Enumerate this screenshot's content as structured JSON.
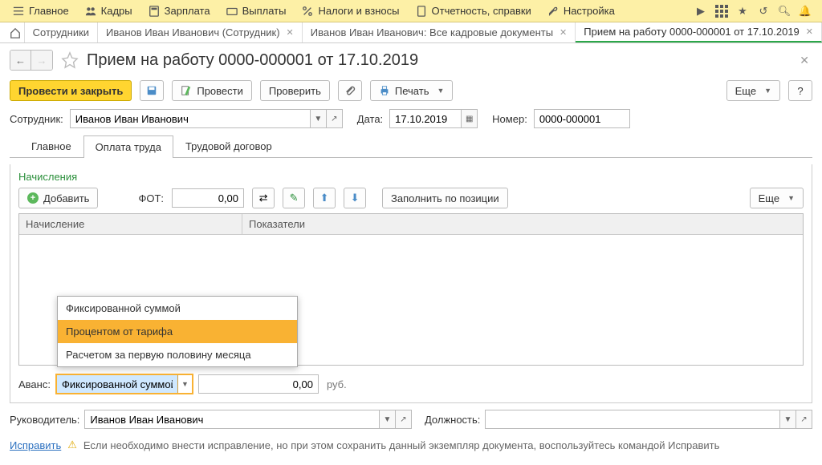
{
  "topmenu": {
    "items": [
      {
        "label": "Главное"
      },
      {
        "label": "Кадры"
      },
      {
        "label": "Зарплата"
      },
      {
        "label": "Выплаты"
      },
      {
        "label": "Налоги и взносы"
      },
      {
        "label": "Отчетность, справки"
      },
      {
        "label": "Настройка"
      }
    ]
  },
  "tabs": {
    "items": [
      {
        "label": "Сотрудники"
      },
      {
        "label": "Иванов Иван Иванович (Сотрудник)"
      },
      {
        "label": "Иванов Иван Иванович: Все кадровые документы"
      },
      {
        "label": "Прием на работу 0000-000001 от 17.10.2019"
      }
    ]
  },
  "page": {
    "title": "Прием на работу 0000-000001 от 17.10.2019"
  },
  "toolbar": {
    "post_close": "Провести и закрыть",
    "post": "Провести",
    "check": "Проверить",
    "print": "Печать",
    "more": "Еще",
    "help": "?"
  },
  "fields": {
    "employee_label": "Сотрудник:",
    "employee_value": "Иванов Иван Иванович",
    "date_label": "Дата:",
    "date_value": "17.10.2019",
    "number_label": "Номер:",
    "number_value": "0000-000001"
  },
  "inner_tabs": {
    "main": "Главное",
    "salary": "Оплата труда",
    "contract": "Трудовой договор"
  },
  "salary_tab": {
    "accruals_label": "Начисления",
    "add": "Добавить",
    "fot_label": "ФОТ:",
    "fot_value": "0,00",
    "fill_by_position": "Заполнить по позиции",
    "more": "Еще",
    "col_accrual": "Начисление",
    "col_indicators": "Показатели",
    "avans_label": "Аванс:",
    "avans_value": "Фиксированной суммой",
    "avans_amount": "0,00",
    "avans_unit": "руб."
  },
  "popup": {
    "items": [
      {
        "label": "Фиксированной суммой"
      },
      {
        "label": "Процентом от тарифа"
      },
      {
        "label": "Расчетом за первую половину месяца"
      }
    ]
  },
  "footer": {
    "manager_label": "Руководитель:",
    "manager_value": "Иванов Иван Иванович",
    "position_label": "Должность:",
    "position_value": "",
    "fix_link": "Исправить",
    "warning_text": "Если необходимо внести исправление, но при этом сохранить данный экземпляр документа, воспользуйтесь командой Исправить"
  }
}
